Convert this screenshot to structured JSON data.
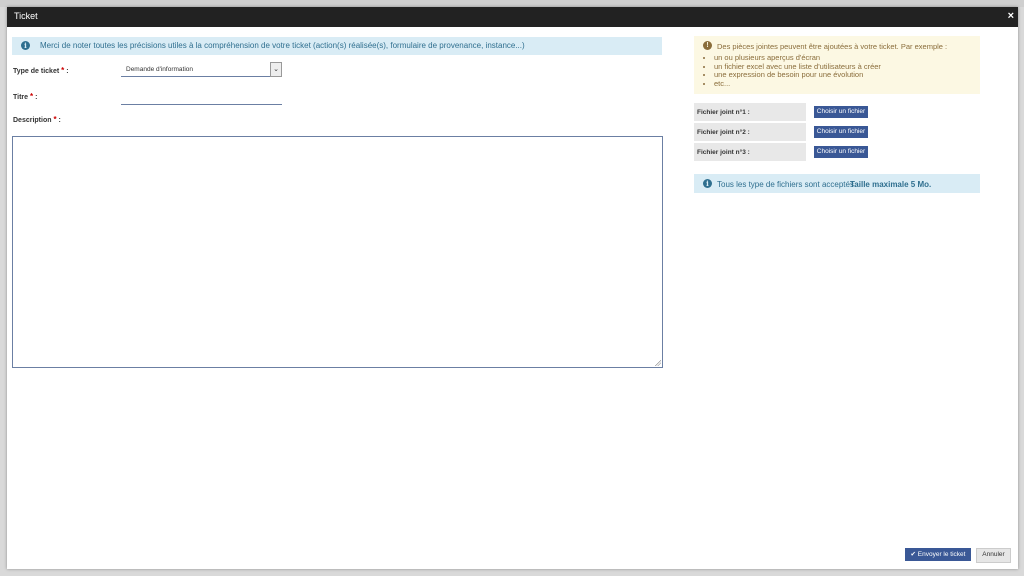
{
  "modal": {
    "title": "Ticket",
    "close_icon": "×"
  },
  "info_banner": {
    "text": "Merci de noter toutes les précisions utiles à la compréhension de votre ticket (action(s) réalisée(s), formulaire de provenance, instance...)"
  },
  "form": {
    "type_label": "Type de ticket",
    "type_value": "Demande d'information",
    "titre_label": "Titre",
    "description_label": "Description",
    "required_mark": "*",
    "colon": ":"
  },
  "attachments": {
    "intro": "Des pièces jointes peuvent être ajoutées à votre ticket. Par exemple :",
    "examples": [
      "un ou plusieurs aperçus d'écran",
      "un fichier excel avec une liste d'utilisateurs à créer",
      "une expression de besoin pour une évolution",
      "etc..."
    ],
    "files": [
      {
        "label": "Fichier joint n°1 :",
        "button": "Choisir un fichier"
      },
      {
        "label": "Fichier joint n°2 :",
        "button": "Choisir un fichier"
      },
      {
        "label": "Fichier joint n°3 :",
        "button": "Choisir un fichier"
      }
    ],
    "note": "Tous les type de fichiers sont acceptés.",
    "note_bold": "Taille maximale 5 Mo."
  },
  "footer": {
    "send": "Envoyer le ticket",
    "cancel": "Annuler"
  },
  "colors": {
    "primary": "#3a5896",
    "titlebar": "#222222",
    "info_bg": "#d9ecf5",
    "warn_bg": "#fcf8e3"
  }
}
